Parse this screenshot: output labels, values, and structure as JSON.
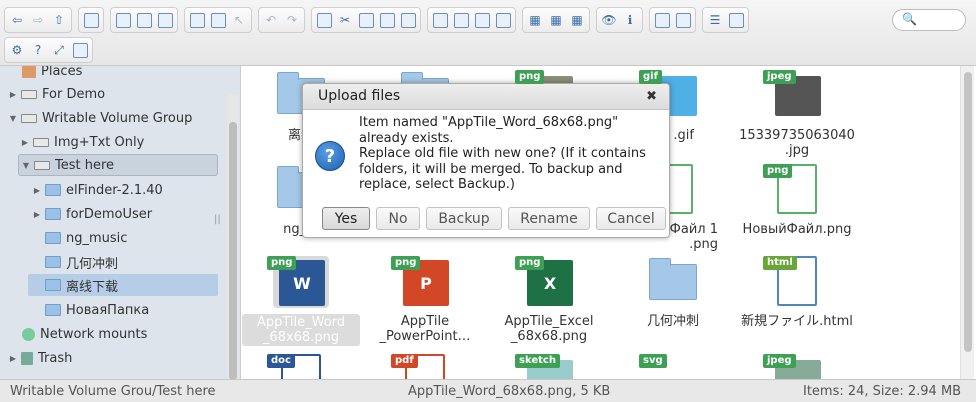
{
  "search": {
    "glyph": "🔍"
  },
  "sidebar": {
    "items": [
      {
        "label": "Places"
      },
      {
        "label": "For Demo"
      },
      {
        "label": "Writable Volume Group"
      },
      {
        "label": "Img+Txt Only"
      },
      {
        "label": "Test here"
      },
      {
        "label": "elFinder-2.1.40"
      },
      {
        "label": "forDemoUser"
      },
      {
        "label": "ng_music"
      },
      {
        "label": "几何冲刺"
      },
      {
        "label": "离线下载"
      },
      {
        "label": "НоваяПапка"
      },
      {
        "label": "Network mounts"
      },
      {
        "label": "Trash"
      }
    ]
  },
  "files": [
    {
      "name": "离线",
      "type": "folder"
    },
    {
      "name": "",
      "type": "folder"
    },
    {
      "name": "",
      "type": "png",
      "badge": "png"
    },
    {
      "name": ".gif",
      "type": "gif",
      "badge": "gif"
    },
    {
      "name": "15339735063040\n.jpg",
      "type": "jpeg",
      "badge": "jpeg"
    },
    {
      "name": "ng_m",
      "type": "folder"
    },
    {
      "name": "Файл 1\n.png",
      "type": "png",
      "badge": "png"
    },
    {
      "name": "НовыйФайл.png",
      "type": "png",
      "badge": "png"
    },
    {
      "name": "AppTile_Word\n_68x68.png",
      "type": "png",
      "badge": "png",
      "app": "W",
      "color": "#2b5797"
    },
    {
      "name": "AppTile\n_PowerPoint…",
      "type": "png",
      "badge": "png",
      "app": "P",
      "color": "#d24726"
    },
    {
      "name": "AppTile_Excel\n_68x68.png",
      "type": "png",
      "badge": "png",
      "app": "X",
      "color": "#1e7145"
    },
    {
      "name": "几何冲刺",
      "type": "folder"
    },
    {
      "name": "新規ファイル.html",
      "type": "html",
      "badge": "html"
    },
    {
      "name": "",
      "type": "doc",
      "badge": "doc"
    },
    {
      "name": "",
      "type": "pdf",
      "badge": "pdf"
    },
    {
      "name": "",
      "type": "sketch",
      "badge": "sketch"
    },
    {
      "name": "",
      "type": "svg",
      "badge": "svg"
    },
    {
      "name": "",
      "type": "jpeg",
      "badge": "jpeg"
    }
  ],
  "dialog": {
    "title": "Upload files",
    "close": "✖",
    "icon": "?",
    "message_line1": "Item named \"AppTile_Word_68x68.png\"",
    "message_line2": "already exists.",
    "message_line3": "Replace old file with new one? (If it contains",
    "message_line4": "folders, it will be merged. To backup and",
    "message_line5": "replace, select Backup.)",
    "buttons": {
      "yes": "Yes",
      "no": "No",
      "backup": "Backup",
      "rename": "Rename",
      "cancel": "Cancel"
    }
  },
  "status": {
    "path": "Writable Volume Grou/Test here",
    "selected": "AppTile_Word_68x68.png, 5 KB",
    "items": "Items: 24, Size: 2.94 MB"
  },
  "colors": {
    "accent": "#2b5797",
    "badge_green": "#3ea055",
    "sidebar_bg": "#dde4eb"
  }
}
